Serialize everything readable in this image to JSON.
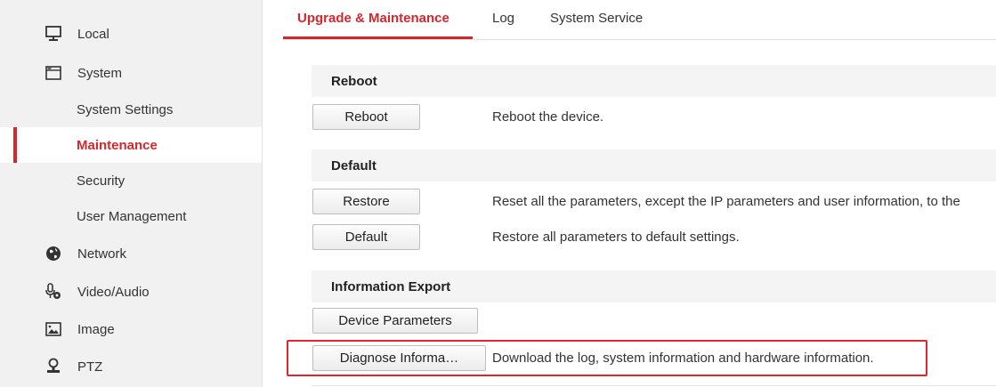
{
  "sidebar": {
    "items": [
      {
        "label": "Local",
        "icon": "monitor-icon"
      },
      {
        "label": "System",
        "icon": "window-icon"
      },
      {
        "label": "System Settings"
      },
      {
        "label": "Maintenance"
      },
      {
        "label": "Security"
      },
      {
        "label": "User Management"
      },
      {
        "label": "Network",
        "icon": "globe-icon"
      },
      {
        "label": "Video/Audio",
        "icon": "microphone-camera-icon"
      },
      {
        "label": "Image",
        "icon": "image-icon"
      },
      {
        "label": "PTZ",
        "icon": "ptz-camera-icon"
      }
    ],
    "active": "Maintenance"
  },
  "tabs": [
    {
      "label": "Upgrade & Maintenance",
      "active": true
    },
    {
      "label": "Log"
    },
    {
      "label": "System Service"
    }
  ],
  "sections": {
    "reboot": {
      "title": "Reboot",
      "button": "Reboot",
      "desc": "Reboot the device."
    },
    "default": {
      "title": "Default",
      "restore_button": "Restore",
      "restore_desc": "Reset all the parameters, except the IP parameters and user information, to the",
      "default_button": "Default",
      "default_desc": "Restore all parameters to default settings."
    },
    "export": {
      "title": "Information Export",
      "device_params_button": "Device Parameters",
      "diagnose_button": "Diagnose Informa…",
      "diagnose_desc": "Download the log, system information and hardware information."
    }
  },
  "colors": {
    "accent": "#d6262c",
    "highlight_box": "#e0262c",
    "sidebar_bg": "#f1f1f1",
    "section_bg": "#f4f4f4"
  }
}
